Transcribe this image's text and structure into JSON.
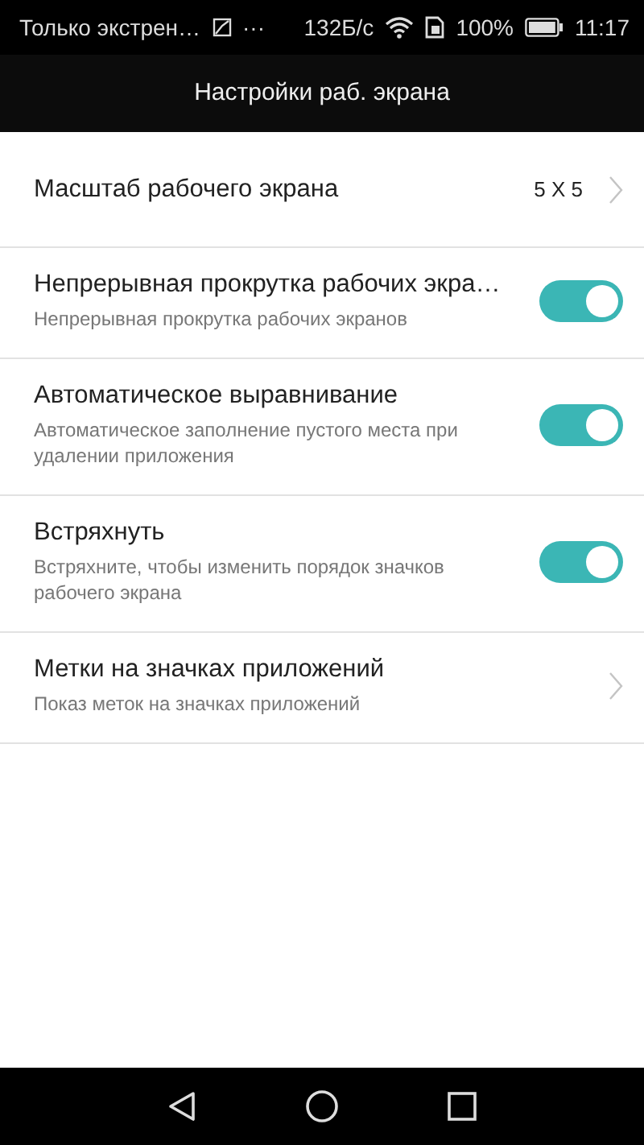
{
  "status_bar": {
    "notification": "Только экстрен…",
    "dots": "···",
    "speed": "132Б/с",
    "battery": "100%",
    "time": "11:17"
  },
  "header": {
    "title": "Настройки раб. экрана"
  },
  "settings": [
    {
      "kind": "nav",
      "title": "Масштаб рабочего экрана",
      "value": "5 X 5"
    },
    {
      "kind": "toggle",
      "title": "Непрерывная прокрутка рабочих экра…",
      "subtitle": "Непрерывная прокрутка рабочих экранов",
      "on": true
    },
    {
      "kind": "toggle",
      "title": "Автоматическое выравнивание",
      "subtitle": "Автоматическое заполнение пустого места при удалении приложения",
      "on": true
    },
    {
      "kind": "toggle",
      "title": "Встряхнуть",
      "subtitle": "Встряхните, чтобы изменить порядок значков рабочего экрана",
      "on": true
    },
    {
      "kind": "nav",
      "title": "Метки на значках приложений",
      "subtitle": "Показ меток на значках приложений"
    }
  ]
}
